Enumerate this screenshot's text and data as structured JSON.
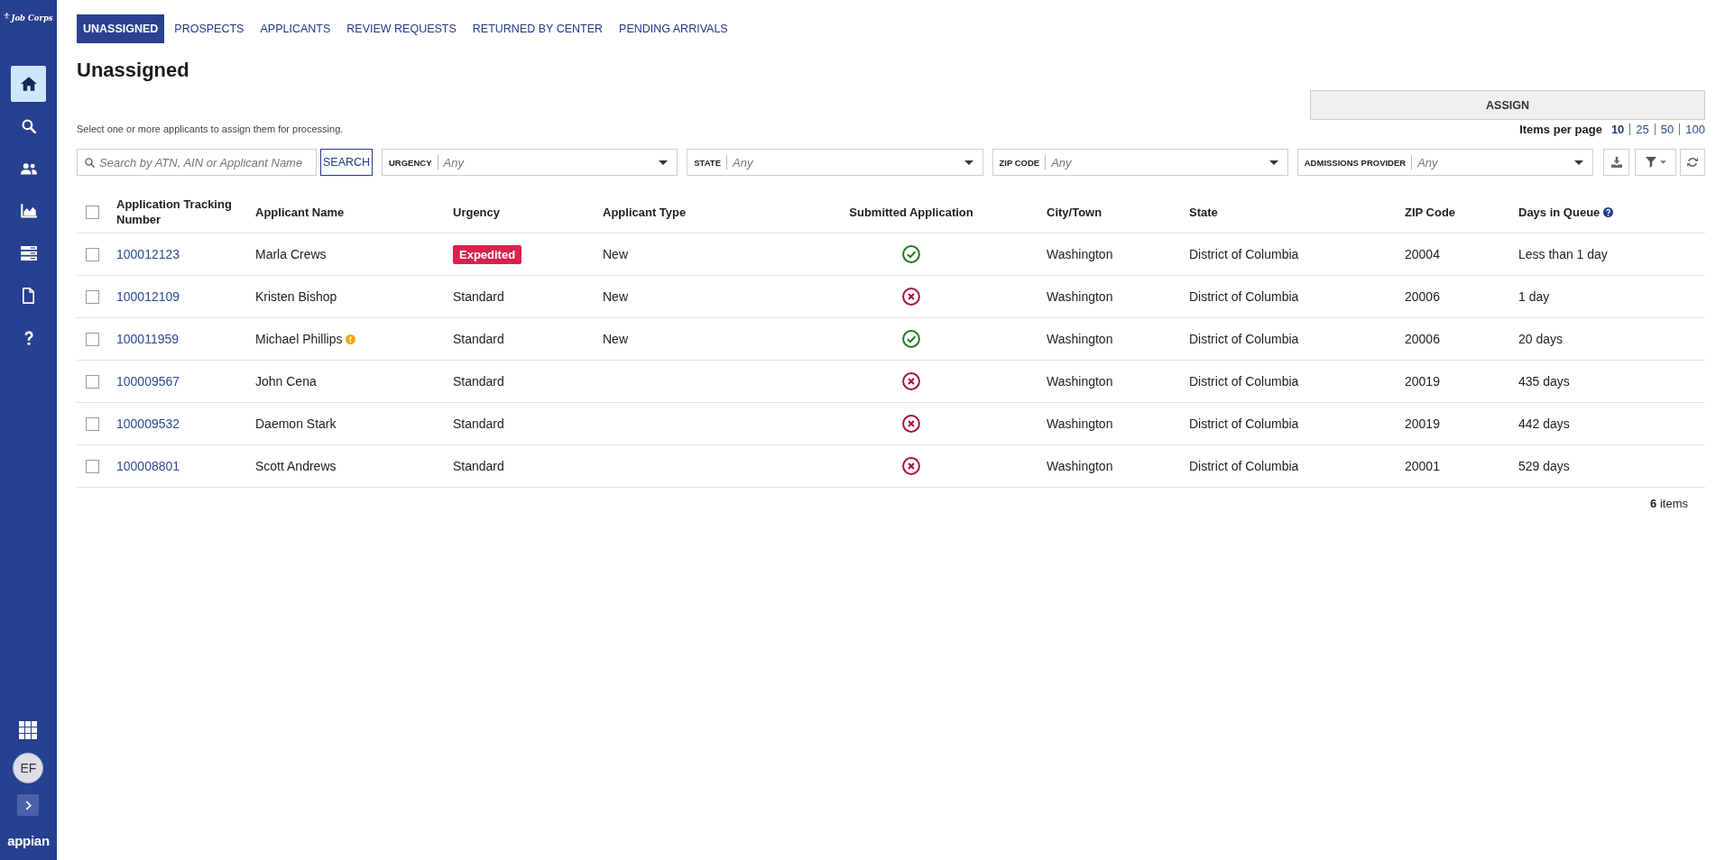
{
  "sidebar": {
    "logo": "Job Corps",
    "nav": [
      {
        "selected": true
      },
      {
        "selected": false
      },
      {
        "selected": false
      },
      {
        "selected": false
      },
      {
        "selected": false
      },
      {
        "selected": false
      },
      {
        "selected": false
      }
    ],
    "user": {
      "initials": "EF"
    },
    "brand": "appian"
  },
  "tabs": [
    {
      "label": "UNASSIGNED",
      "selected": true
    },
    {
      "label": "PROSPECTS",
      "selected": false
    },
    {
      "label": "APPLICANTS",
      "selected": false
    },
    {
      "label": "REVIEW REQUESTS",
      "selected": false
    },
    {
      "label": "RETURNED BY CENTER",
      "selected": false
    },
    {
      "label": "PENDING ARRIVALS",
      "selected": false
    }
  ],
  "page": {
    "title": "Unassigned",
    "description": "Select one or more applicants to assign them for processing."
  },
  "assign_button": "ASSIGN",
  "pagination": {
    "label": "Items per page",
    "options": [
      {
        "label": "10",
        "selected": true
      },
      {
        "label": "25",
        "selected": false
      },
      {
        "label": "50",
        "selected": false
      },
      {
        "label": "100",
        "selected": false
      }
    ]
  },
  "search": {
    "placeholder": "Search by ATN, AIN or Applicant Name",
    "button": "SEARCH"
  },
  "filters": [
    {
      "label": "URGENCY",
      "value": "Any"
    },
    {
      "label": "STATE",
      "value": "Any"
    },
    {
      "label": "ZIP CODE",
      "value": "Any"
    },
    {
      "label": "ADMISSIONS PROVIDER",
      "value": "Any"
    }
  ],
  "table": {
    "select_all": {
      "checked": false
    },
    "columns": [
      {
        "label": "Application Tracking Number",
        "help": false
      },
      {
        "label": "Applicant Name",
        "help": false
      },
      {
        "label": "Urgency",
        "help": false
      },
      {
        "label": "Applicant Type",
        "help": false
      },
      {
        "label": "Submitted Application",
        "help": false
      },
      {
        "label": "City/Town",
        "help": false
      },
      {
        "label": "State",
        "help": false
      },
      {
        "label": "ZIP Code",
        "help": false
      },
      {
        "label": "Days in Queue",
        "help": true
      }
    ],
    "rows": [
      {
        "checked": false,
        "atn": "100012123",
        "name": "Marla Crews",
        "alert": false,
        "urgency": {
          "text": "Expedited",
          "kind": "badge"
        },
        "applicant_type": "New",
        "submitted": true,
        "city": "Washington",
        "state": "District of Columbia",
        "zip": "20004",
        "days": "Less than 1 day"
      },
      {
        "checked": false,
        "atn": "100012109",
        "name": "Kristen Bishop",
        "alert": false,
        "urgency": {
          "text": "Standard",
          "kind": "plain"
        },
        "applicant_type": "New",
        "submitted": false,
        "city": "Washington",
        "state": "District of Columbia",
        "zip": "20006",
        "days": "1 day"
      },
      {
        "checked": false,
        "atn": "100011959",
        "name": "Michael Phillips",
        "alert": true,
        "urgency": {
          "text": "Standard",
          "kind": "plain"
        },
        "applicant_type": "New",
        "submitted": true,
        "city": "Washington",
        "state": "District of Columbia",
        "zip": "20006",
        "days": "20 days"
      },
      {
        "checked": false,
        "atn": "100009567",
        "name": "John Cena",
        "alert": false,
        "urgency": {
          "text": "Standard",
          "kind": "plain"
        },
        "submitted": false,
        "city": "Washington",
        "state": "District of Columbia",
        "zip": "20019",
        "days": "435 days"
      },
      {
        "checked": false,
        "atn": "100009532",
        "name": "Daemon Stark",
        "alert": false,
        "urgency": {
          "text": "Standard",
          "kind": "plain"
        },
        "submitted": false,
        "city": "Washington",
        "state": "District of Columbia",
        "zip": "20019",
        "days": "442 days"
      },
      {
        "checked": false,
        "atn": "100008801",
        "name": "Scott Andrews",
        "alert": false,
        "urgency": {
          "text": "Standard",
          "kind": "plain"
        },
        "submitted": false,
        "city": "Washington",
        "state": "District of Columbia",
        "zip": "20001",
        "days": "529 days"
      }
    ]
  },
  "footer": {
    "count": "**6** items"
  }
}
